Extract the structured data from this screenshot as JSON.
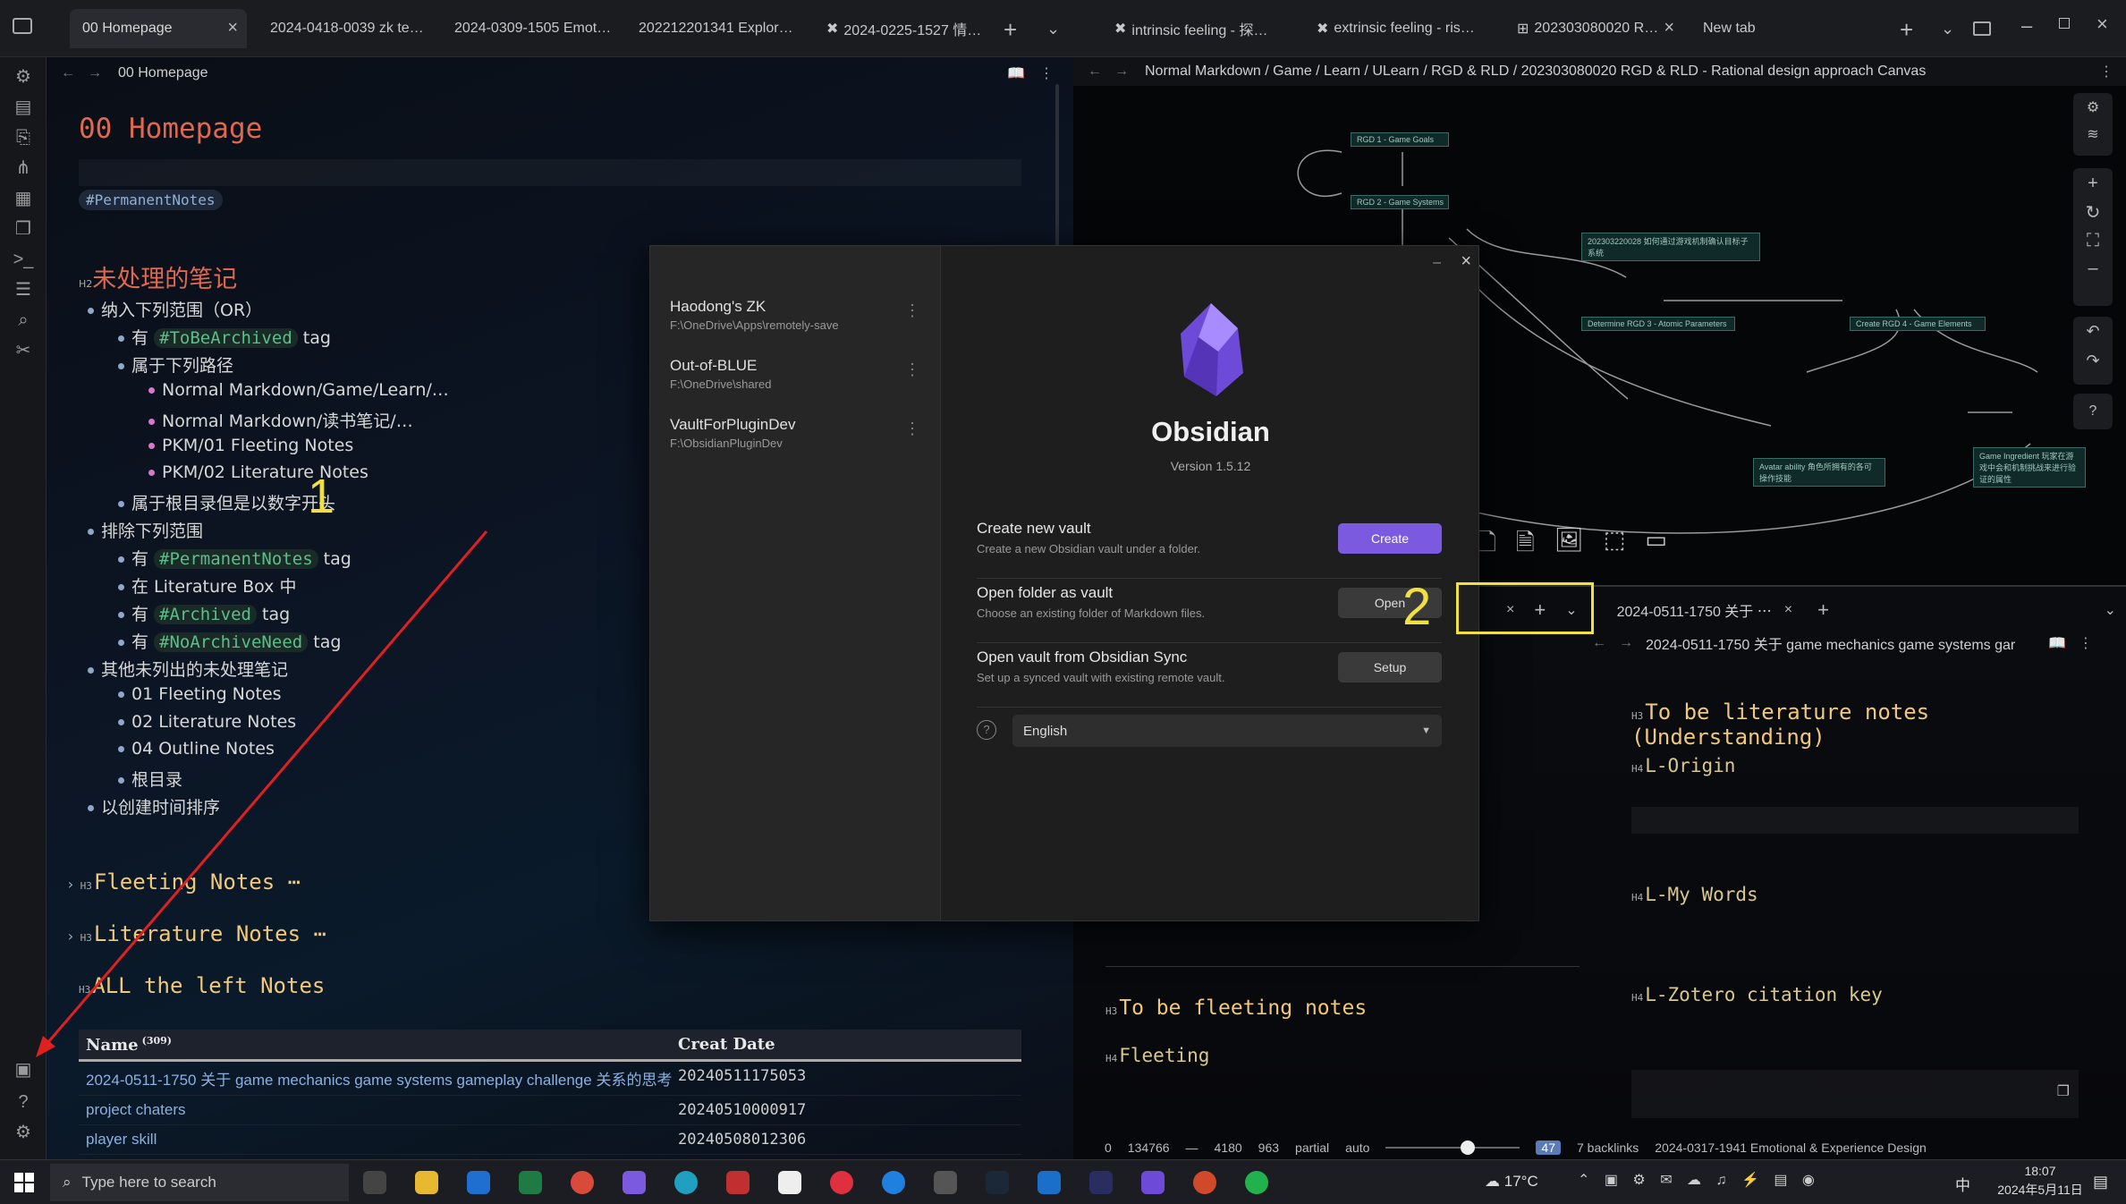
{
  "tabs_left": [
    {
      "label": "00 Homepage",
      "active": true
    },
    {
      "label": "2024-0418-0039 zk te…"
    },
    {
      "label": "2024-0309-1505 Emot…"
    },
    {
      "label": "202212201341 Explor…"
    },
    {
      "label": "2024-0225-1527 情…"
    }
  ],
  "tabs_right": [
    {
      "label": "intrinsic feeling - 探…"
    },
    {
      "label": "extrinsic feeling - ris…"
    },
    {
      "label": "202303080020 R…"
    },
    {
      "label": "New tab"
    }
  ],
  "left_view": {
    "title": "00 Homepage",
    "page_title": "00 Homepage",
    "tag": "#PermanentNotes",
    "h2": "未处理的笔记",
    "h2_marker": "H2",
    "list": [
      {
        "text": "纳入下列范围（OR）",
        "indent": 0
      },
      {
        "text": "有 ",
        "tag": "#ToBeArchived",
        "after": " tag",
        "indent": 1
      },
      {
        "text": "属于下列路径",
        "indent": 1
      },
      {
        "text": "Normal Markdown/Game/Learn/…",
        "indent": 2
      },
      {
        "text": "Normal Markdown/读书笔记/…",
        "indent": 2
      },
      {
        "text": "PKM/01 Fleeting Notes",
        "indent": 2
      },
      {
        "text": "PKM/02 Literature Notes",
        "indent": 2
      },
      {
        "text": "属于根目录但是以数字开头",
        "indent": 1
      },
      {
        "text": "排除下列范围",
        "indent": 0
      },
      {
        "text": "有 ",
        "tag": "#PermanentNotes",
        "after": " tag",
        "indent": 1
      },
      {
        "text": "在 Literature Box 中",
        "indent": 1
      },
      {
        "text": "有 ",
        "tag": "#Archived",
        "after": " tag",
        "indent": 1
      },
      {
        "text": "有 ",
        "tag": "#NoArchiveNeed",
        "after": " tag",
        "indent": 1
      },
      {
        "text": "其他未列出的未处理笔记",
        "indent": 0
      },
      {
        "text": "01 Fleeting Notes",
        "indent": 1
      },
      {
        "text": "02 Literature Notes",
        "indent": 1
      },
      {
        "text": "04 Outline Notes",
        "indent": 1
      },
      {
        "text": "根目录",
        "indent": 1
      },
      {
        "text": "以创建时间排序",
        "indent": 0
      }
    ],
    "h3_a": "Fleeting Notes ⋯",
    "h3_b": "Literature Notes ⋯",
    "h3_c": "ALL the left Notes",
    "h3_marker": "H3",
    "annotation_1": "1",
    "table": {
      "col1": "Name",
      "count": "(309)",
      "col2": "Creat Date",
      "rows": [
        {
          "name": "2024-0511-1750 关于 game mechanics game systems gameplay challenge 关系的思考",
          "date": "20240511175053"
        },
        {
          "name": "project chaters",
          "date": "20240510000917"
        },
        {
          "name": "player skill",
          "date": "20240508012306"
        }
      ]
    }
  },
  "canvas": {
    "breadcrumb": "Normal Markdown / Game / Learn / ULearn / RGD & RLD / 202303080020 RGD & RLD - Rational design approach Canvas",
    "nodes": [
      "RGD 1 - Game Goals",
      "RGD 2 - Game Systems",
      "202303220028 如何通过游戏机制确认目标子系统",
      "Determine RGD 3 - Atomic Parameters",
      "Create RGD 4 - Game Elements",
      "Avatar ability 角色所拥有的各可操作技能",
      "Game Ingredient 玩家在游戏中会和机制挑战来进行验证的属性"
    ]
  },
  "right_bottom": {
    "tab": "2024-0511-1750 关于 ⋯",
    "view_title": "2024-0511-1750 关于 game mechanics game systems gar",
    "h3": "To be literature notes (Understanding)",
    "h4_a": "L-Origin",
    "h4_b": "L-My Words",
    "h4_c": "L-Zotero citation key",
    "h3_fleet": "To be fleeting notes",
    "h4_fleet": "Fleeting",
    "m3": "H3",
    "m4": "H4"
  },
  "dialog": {
    "vaults": [
      {
        "name": "Haodong's ZK",
        "path": "F:\\OneDrive\\Apps\\remotely-save"
      },
      {
        "name": "Out-of-BLUE",
        "path": "F:\\OneDrive\\shared"
      },
      {
        "name": "VaultForPluginDev",
        "path": "F:\\ObsidianPluginDev"
      }
    ],
    "app_name": "Obsidian",
    "version": "Version 1.5.12",
    "options": [
      {
        "title": "Create new vault",
        "desc": "Create a new Obsidian vault under a folder.",
        "button": "Create"
      },
      {
        "title": "Open folder as vault",
        "desc": "Choose an existing folder of Markdown files.",
        "button": "Open"
      },
      {
        "title": "Open vault from Obsidian Sync",
        "desc": "Set up a synced vault with existing remote vault.",
        "button": "Setup"
      }
    ],
    "language": "English",
    "annotation_2": "2",
    "accent": "#7b5ae0"
  },
  "status_bar": {
    "items": [
      "0",
      "134766",
      "—",
      "4180",
      "963",
      "partial",
      "auto"
    ],
    "badge": "47",
    "backlinks": "7 backlinks",
    "file": "2024-0317-1941 Emotional & Experience Design"
  },
  "taskbar": {
    "search_placeholder": "Type here to search",
    "weather": "17°C",
    "ime": "中",
    "time": "18:07",
    "date": "2024年5月11日"
  }
}
